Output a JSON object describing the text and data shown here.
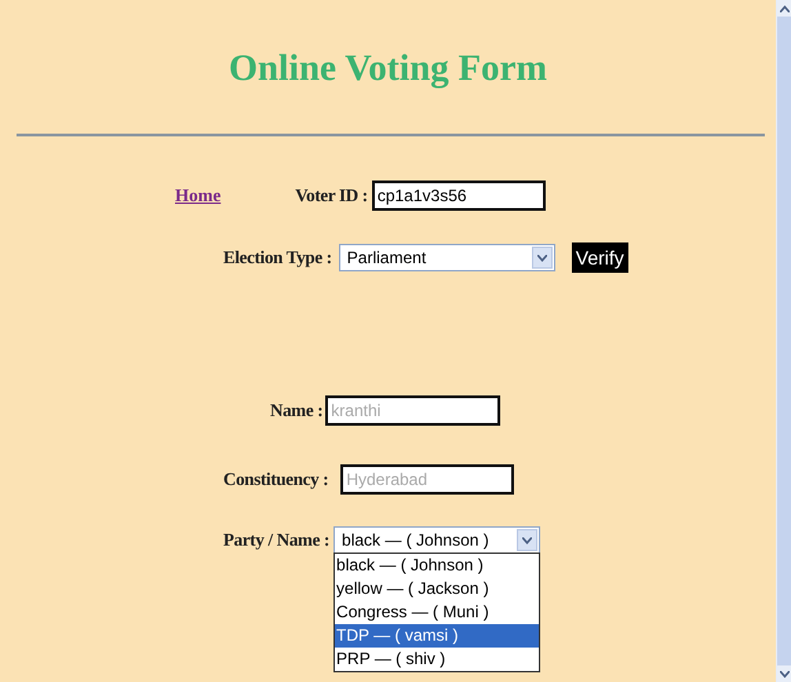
{
  "title": "Online Voting Form",
  "home_link": "Home",
  "voter_id": {
    "label": "Voter ID :",
    "value": "cp1a1v3s56"
  },
  "election_type": {
    "label": "Election Type :",
    "value": "Parliament"
  },
  "verify_button": "Verify",
  "name": {
    "label": "Name :",
    "placeholder": "kranthi"
  },
  "constituency": {
    "label": "Constituency :",
    "placeholder": "Hyderabad"
  },
  "party": {
    "label": "Party / Name :",
    "value": "black — ( Johnson )",
    "expanded": true,
    "options": [
      {
        "label": "black — ( Johnson )",
        "highlighted": false
      },
      {
        "label": "yellow — ( Jackson )",
        "highlighted": false
      },
      {
        "label": "Congress — ( Muni )",
        "highlighted": false
      },
      {
        "label": "TDP — ( vamsi )",
        "highlighted": true
      },
      {
        "label": "PRP — ( shiv )",
        "highlighted": false
      }
    ]
  }
}
